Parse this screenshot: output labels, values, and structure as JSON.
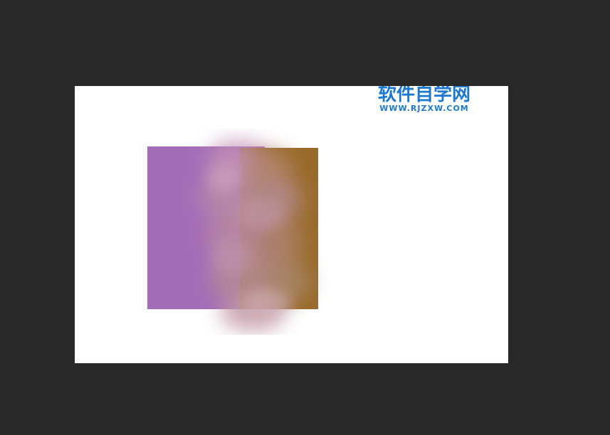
{
  "watermark": {
    "title": "软件自学网",
    "url": "WWW.RJZXW.COM"
  },
  "colors": {
    "workspace_bg": "#282828",
    "canvas_bg": "#ffffff",
    "purple_fill": "#a46db8",
    "brown_fill": "#9a6a2a",
    "smudge": "#b38aa0",
    "watermark": "#1b78d0"
  }
}
